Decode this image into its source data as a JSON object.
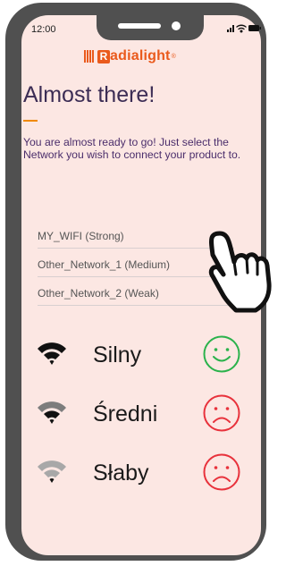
{
  "status_bar": {
    "time": "12:00"
  },
  "logo": {
    "letter": "R",
    "text": "adialight",
    "reg": "®"
  },
  "page": {
    "title": "Almost there!",
    "intro": "You are almost ready to go! Just select the Network you wish to connect your product to."
  },
  "networks": [
    {
      "label": "MY_WIFI  (Strong)"
    },
    {
      "label": "Other_Network_1  (Medium)"
    },
    {
      "label": "Other_Network_2  (Weak)"
    }
  ],
  "legend": [
    {
      "label": "Silny",
      "icon": "wifi-strong-icon",
      "face": "smile-face-icon",
      "face_color": "#2bb24c",
      "wifi_color": "#111111"
    },
    {
      "label": "Średni",
      "icon": "wifi-medium-icon",
      "face": "frown-face-icon",
      "face_color": "#e8323c",
      "wifi_color": "#7d7d7d"
    },
    {
      "label": "Słaby",
      "icon": "wifi-weak-icon",
      "face": "frown-face-icon",
      "face_color": "#e8323c",
      "wifi_color": "#a8a8a8"
    }
  ],
  "colors": {
    "accent": "#ea5a1c",
    "title": "#3c2d55",
    "intro": "#4a2d6b",
    "frame": "#505050",
    "screen": "#fce7e3"
  }
}
